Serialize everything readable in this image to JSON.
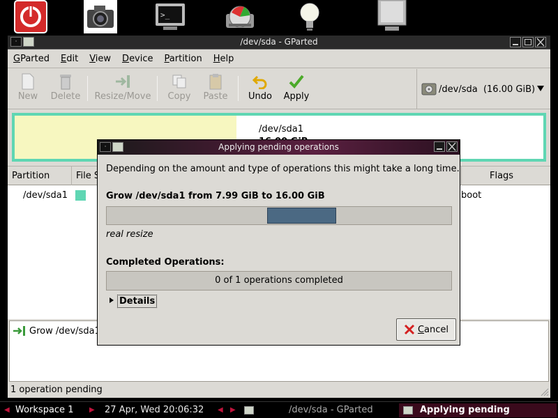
{
  "colors": {
    "accent": "#5fd6b3",
    "progress": "#4b6983",
    "unallocated_used": "#f7f7c0",
    "cancel_icon": "#d42020"
  },
  "dock": {
    "icons": [
      "power-icon",
      "camera-icon",
      "terminal-icon",
      "disk-usage-icon",
      "lightbulb-icon",
      "monitor-icon"
    ]
  },
  "window": {
    "title": "/dev/sda - GParted",
    "menu": [
      {
        "mnemonic": "G",
        "rest": "Parted"
      },
      {
        "mnemonic": "E",
        "rest": "dit"
      },
      {
        "mnemonic": "V",
        "rest": "iew"
      },
      {
        "mnemonic": "D",
        "rest": "evice"
      },
      {
        "mnemonic": "P",
        "rest": "artition"
      },
      {
        "mnemonic": "H",
        "rest": "elp"
      }
    ],
    "toolbar": {
      "new": "New",
      "delete": "Delete",
      "resize_move": "Resize/Move",
      "copy": "Copy",
      "paste": "Paste",
      "undo": "Undo",
      "apply": "Apply"
    },
    "device_selector": "/dev/sda  (16.00 GiB)",
    "graph": {
      "label": "/dev/sda1",
      "size": "16.00 GiB"
    },
    "columns": {
      "partition": "Partition",
      "filesystem": "File S",
      "flags": "Flags"
    },
    "partition_row": {
      "name": "/dev/sda1",
      "flags": "boot"
    },
    "pending_op": "Grow /dev/sda1",
    "status": "1 operation pending"
  },
  "dialog": {
    "title": "Applying pending operations",
    "intro": "Depending on the amount and type of operations this might take a long time.",
    "operation": "Grow /dev/sda1 from 7.99 GiB to 16.00 GiB",
    "sub_status": "real resize",
    "completed_label": "Completed Operations:",
    "completed_text": "0 of 1 operations completed",
    "details_label": "Details",
    "cancel_mnemonic": "C",
    "cancel_rest": "ancel"
  },
  "taskbar": {
    "workspace": "Workspace 1",
    "clock": "27 Apr, Wed 20:06:32",
    "task_gparted": "/dev/sda - GParted",
    "task_applying": "Applying pending operations"
  }
}
